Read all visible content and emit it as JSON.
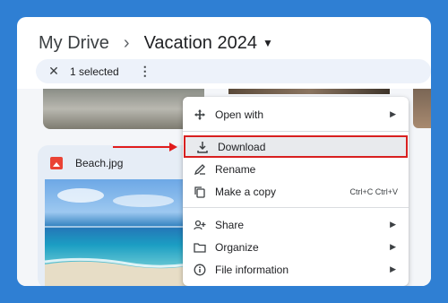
{
  "breadcrumb": {
    "root": "My Drive",
    "separator": "›",
    "current": "Vacation 2024"
  },
  "selection_bar": {
    "count_text": "1 selected"
  },
  "file_card": {
    "name": "Beach.jpg"
  },
  "context_menu": {
    "items": [
      {
        "label": "Open with",
        "icon": "open-with-icon",
        "has_submenu": true
      },
      {
        "label": "Download",
        "icon": "download-icon",
        "highlighted": true
      },
      {
        "label": "Rename",
        "icon": "rename-icon"
      },
      {
        "label": "Make a copy",
        "icon": "copy-icon",
        "shortcut": "Ctrl+C Ctrl+V"
      },
      {
        "label": "Share",
        "icon": "share-icon",
        "has_submenu": true
      },
      {
        "label": "Organize",
        "icon": "folder-icon",
        "has_submenu": true
      },
      {
        "label": "File information",
        "icon": "info-icon",
        "has_submenu": true
      }
    ]
  },
  "colors": {
    "page_background": "#2f7fd3",
    "highlight_border": "#d82020",
    "annotation_arrow": "#e11d1d",
    "image_icon": "#ea4335"
  }
}
